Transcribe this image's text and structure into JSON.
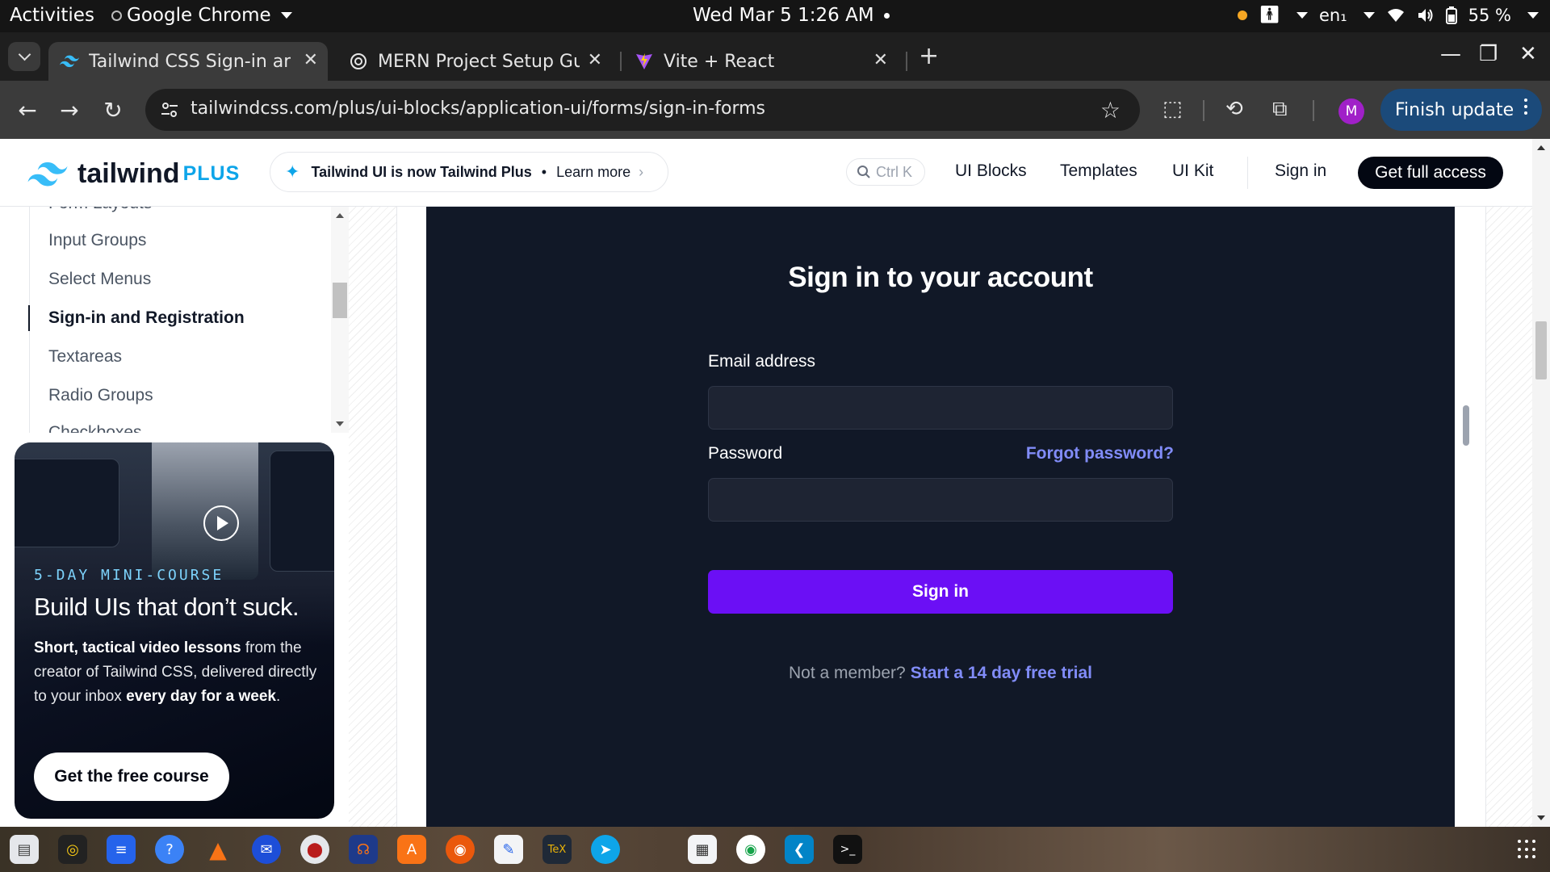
{
  "system_bar": {
    "activities": "Activities",
    "app_name": "Google Chrome",
    "clock": "Wed Mar 5  1:26 AM",
    "keyboard_layout": "en₁",
    "battery": "55 %"
  },
  "tabs": [
    {
      "title": "Tailwind CSS Sign-in and",
      "favicon": "tailwind-icon",
      "active": true
    },
    {
      "title": "MERN Project Setup Gui",
      "favicon": "openai-icon",
      "active": false
    },
    {
      "title": "Vite + React",
      "favicon": "vite-icon",
      "active": false
    }
  ],
  "toolbar": {
    "url": "tailwindcss.com/plus/ui-blocks/application-ui/forms/sign-in-forms",
    "profile_initial": "M",
    "finish_update_label": "Finish update"
  },
  "site_header": {
    "logo_word": "tailwind",
    "logo_plus": "PLUS",
    "announcement": "Tailwind UI is now Tailwind Plus",
    "announcement_link": "Learn more",
    "search_shortcut": "Ctrl K",
    "nav": [
      "UI Blocks",
      "Templates",
      "UI Kit"
    ],
    "sign_in": "Sign in",
    "get_full_access": "Get full access"
  },
  "sidebar": {
    "items": [
      {
        "label": "Form Layouts",
        "active": false
      },
      {
        "label": "Input Groups",
        "active": false
      },
      {
        "label": "Select Menus",
        "active": false
      },
      {
        "label": "Sign-in and Registration",
        "active": true
      },
      {
        "label": "Textareas",
        "active": false
      },
      {
        "label": "Radio Groups",
        "active": false
      },
      {
        "label": "Checkboxes",
        "active": false
      }
    ]
  },
  "promo": {
    "kicker": "5-DAY MINI-COURSE",
    "headline": "Build UIs that don’t suck.",
    "body_bold_1": "Short, tactical video lessons",
    "body_text_1": " from the creator of Tailwind CSS, delivered directly to your inbox ",
    "body_bold_2": "every day for a week",
    "body_text_2": ".",
    "cta": "Get the free course"
  },
  "sign_in_form": {
    "title": "Sign in to your account",
    "email_label": "Email address",
    "email_value": "",
    "password_label": "Password",
    "password_value": "",
    "forgot_link": "Forgot password?",
    "submit_label": "Sign in",
    "member_prompt": "Not a member?",
    "trial_link": "Start a 14 day free trial"
  },
  "colors": {
    "preview_bg": "#111827",
    "primary_button": "#6b0ff5",
    "link": "#818cf8",
    "kicker": "#7dd3fc"
  }
}
